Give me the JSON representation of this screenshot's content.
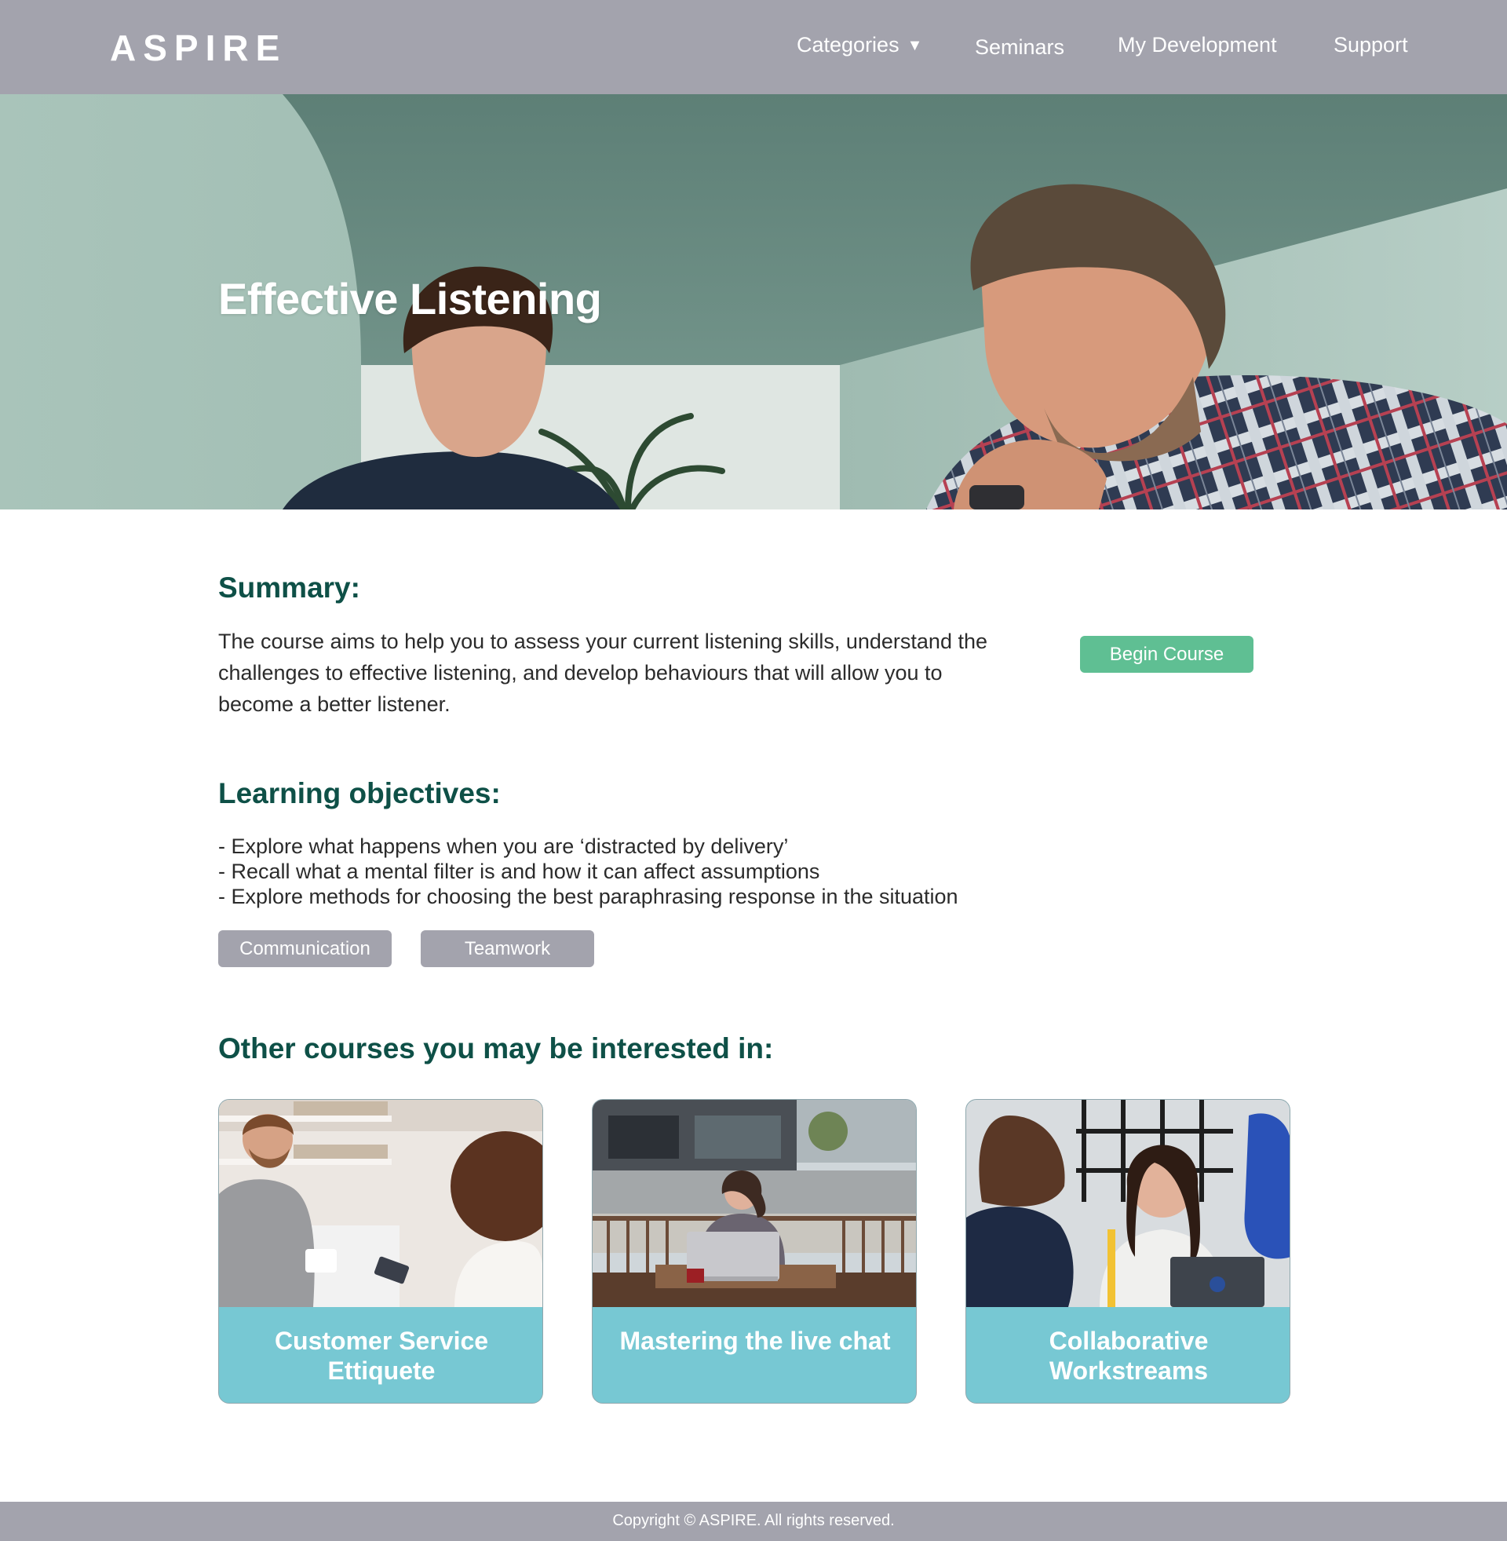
{
  "header": {
    "logo": "ASPIRE",
    "nav": {
      "categories": "Categories",
      "seminars": "Seminars",
      "my_development": "My Development",
      "support": "Support"
    }
  },
  "hero": {
    "title": "Effective Listening"
  },
  "summary": {
    "heading": "Summary:",
    "text": "The course aims to help you to assess your current listening skills, understand the challenges to effective listening, and develop behaviours that will allow you to become a better listener.",
    "begin_button": "Begin Course"
  },
  "objectives": {
    "heading": "Learning objectives:",
    "items": [
      "- Explore what happens when you are ‘distracted by delivery’",
      "- Recall what a mental filter is and how it can affect assumptions",
      "- Explore methods for choosing the best paraphrasing response in the situation"
    ],
    "tags": [
      "Communication",
      "Teamwork"
    ]
  },
  "related": {
    "heading": "Other courses you may be interested in:",
    "courses": [
      {
        "title": "Customer Service Ettiquete"
      },
      {
        "title": "Mastering the live chat"
      },
      {
        "title": "Collaborative Workstreams"
      }
    ]
  },
  "footer": {
    "copyright": "Copyright © ASPIRE. All rights reserved."
  },
  "colors": {
    "header_bg": "#a3a3ad",
    "heading_green": "#0e5047",
    "button_green": "#5fbf93",
    "card_teal": "#77c8d3"
  }
}
